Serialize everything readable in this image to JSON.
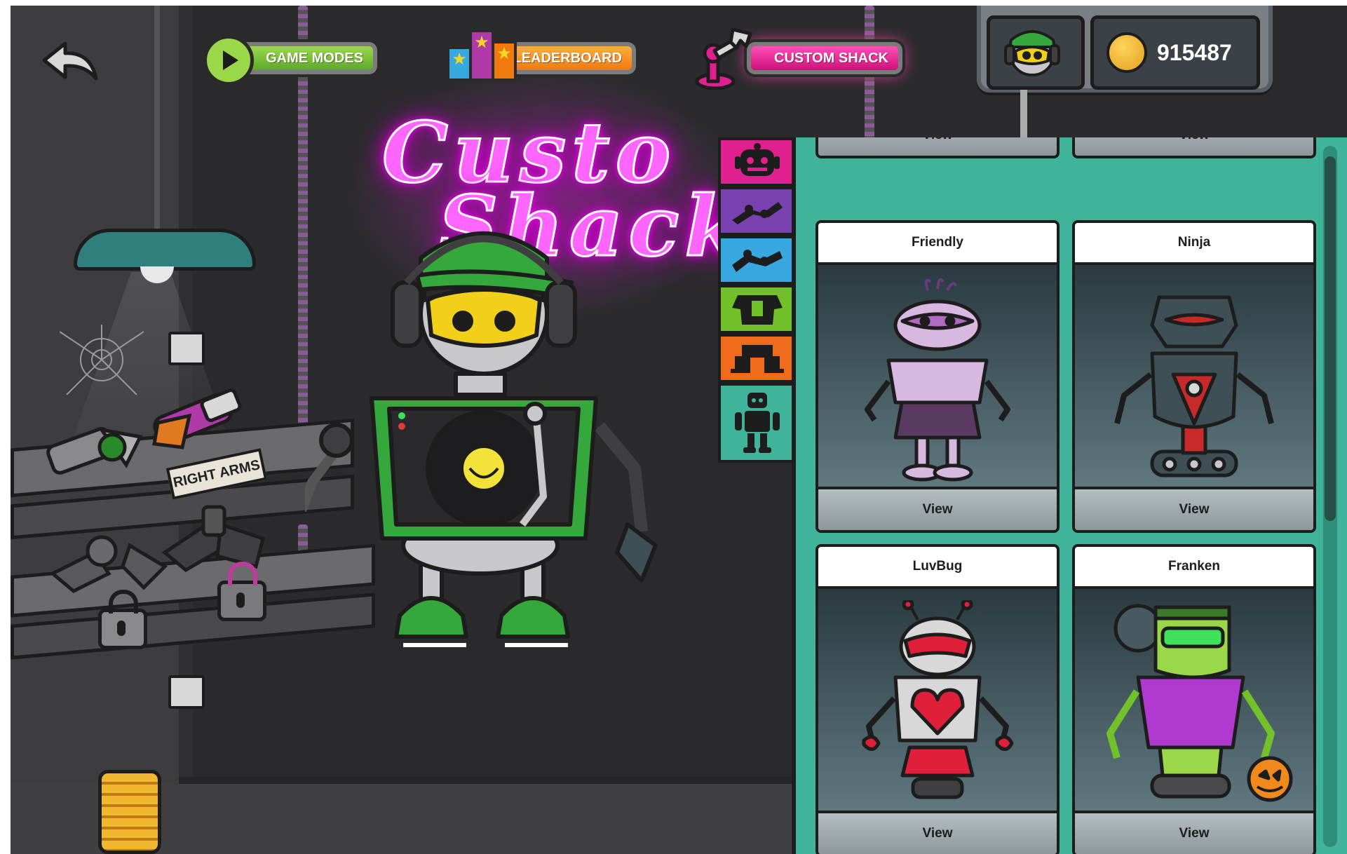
{
  "nav": {
    "game_modes_label": "GAME MODES",
    "leaderboard_label": "LEADERBOARD",
    "custom_shack_label": "CUSTOM SHACK"
  },
  "coins": {
    "amount": "915487"
  },
  "neon_sign": {
    "line1": "Custo",
    "line2": "Shack"
  },
  "shelf_sign": {
    "label": "RIGHT ARMS"
  },
  "category_tabs": [
    {
      "icon": "robot-head-icon",
      "color": "#e0208f"
    },
    {
      "icon": "left-arm-icon",
      "color": "#7a42b0"
    },
    {
      "icon": "right-arm-icon",
      "color": "#38a8e0"
    },
    {
      "icon": "torso-icon",
      "color": "#72c12a"
    },
    {
      "icon": "legs-icon",
      "color": "#f06a1c"
    },
    {
      "icon": "full-robot-icon",
      "color": "#3fb49a",
      "active": true
    }
  ],
  "cards": [
    {
      "title": "",
      "view_label": "View",
      "partial": true
    },
    {
      "title": "",
      "view_label": "View",
      "partial": true
    },
    {
      "title": "Friendly",
      "view_label": "View",
      "robot": "friendly"
    },
    {
      "title": "Ninja",
      "view_label": "View",
      "robot": "ninja"
    },
    {
      "title": "LuvBug",
      "view_label": "View",
      "robot": "luvbug"
    },
    {
      "title": "Franken",
      "view_label": "View",
      "robot": "franken"
    }
  ],
  "colors": {
    "panel_teal": "#3fb49a",
    "nav_green": "#8dd43f",
    "nav_orange": "#f58a1f",
    "nav_pink": "#e0208f",
    "neon_pink": "#ff44ff"
  }
}
